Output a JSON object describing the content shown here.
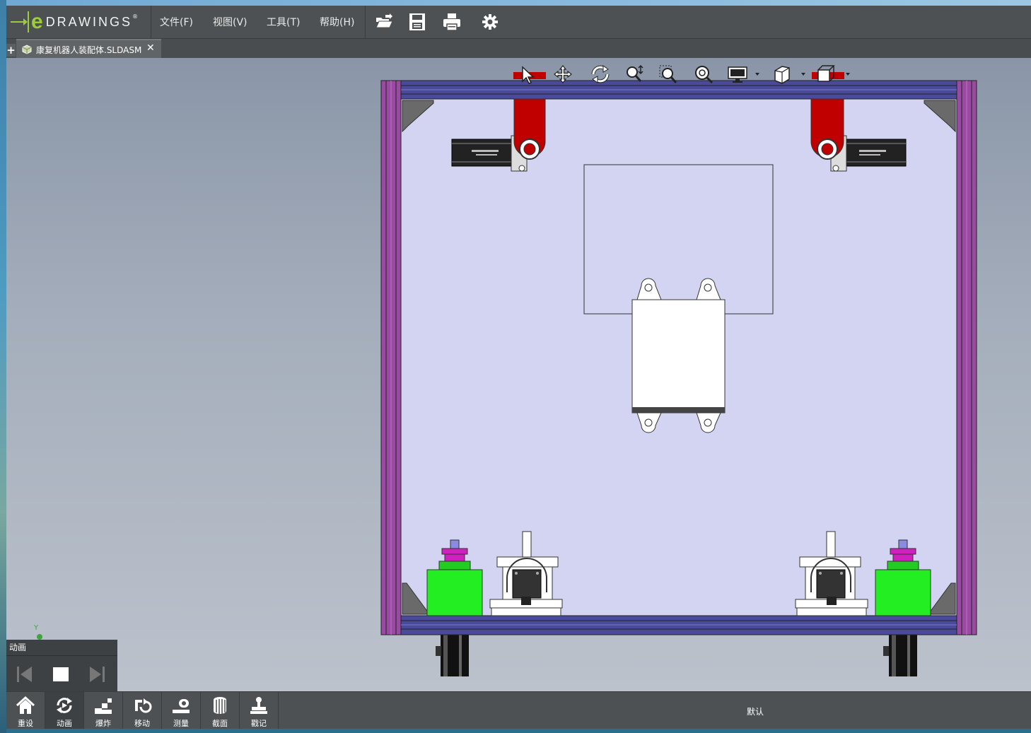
{
  "app": {
    "logo_e": "e",
    "logo_word": "DRAWINGS",
    "logo_mark": "®"
  },
  "menu": [
    "文件(F)",
    "视图(V)",
    "工具(T)",
    "帮助(H)"
  ],
  "toolbar_icons": [
    "open-icon",
    "save-icon",
    "print-icon",
    "settings-icon"
  ],
  "tab": {
    "plus": "+",
    "name": "康复机器人装配体.SLDASM",
    "close": "✕"
  },
  "view_toolbar": [
    "select-icon",
    "pan-icon",
    "rotate-icon",
    "zoom-icon",
    "zoom-area-icon",
    "zoom-fit-icon",
    "display-icon",
    "view-orientation-icon",
    "standard-views-icon"
  ],
  "animation": {
    "title": "动画",
    "buttons": [
      "previous-icon",
      "stop-icon",
      "next-icon"
    ]
  },
  "axis_label": "Y",
  "bottom": {
    "buttons": [
      {
        "label": "重设",
        "icon": "home-icon"
      },
      {
        "label": "动画",
        "icon": "animate-icon"
      },
      {
        "label": "爆炸",
        "icon": "explode-icon"
      },
      {
        "label": "移动",
        "icon": "move-icon"
      },
      {
        "label": "测量",
        "icon": "measure-icon"
      },
      {
        "label": "截面",
        "icon": "section-icon"
      },
      {
        "label": "戳记",
        "icon": "stamp-icon"
      }
    ],
    "config": "默认"
  },
  "colors": {
    "frame_purple": "#9a4aa2",
    "rail_blue": "#4a4a9a",
    "red_part": "#c00000",
    "green_part": "#22ee22",
    "magenta_part": "#d020c0",
    "background_panel": "#d2d4f2"
  }
}
